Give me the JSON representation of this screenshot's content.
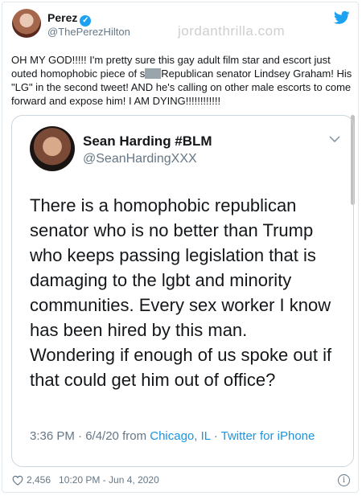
{
  "tweet": {
    "display_name": "Perez",
    "handle": "@ThePerezHilton",
    "verified_glyph": "✓",
    "text_before_redaction": "OH MY GOD!!!!! I'm pretty sure this gay adult film star and escort just outed homophobic piece of s",
    "text_after_redaction": "Republican senator Lindsey Graham! His \"LG\" in the second tweet! AND he's calling on other male escorts to come forward and expose him! I AM DYING!!!!!!!!!!!!",
    "likes": "2,456",
    "timestamp": "10:20 PM - Jun 4, 2020",
    "info_glyph": "i"
  },
  "watermark": "jordanthrilla.com",
  "quoted_tweet": {
    "display_name": "Sean Harding #BLM",
    "handle": "@SeanHardingXXX",
    "text": "There is a homophobic republican senator who is no better than Trump who keeps passing legislation that is damaging to the lgbt and minority communities. Every sex worker I know has been hired by this man. Wondering if enough of us spoke out if that could get him out of office?",
    "time": "3:36 PM · 6/4/20 from ",
    "location": "Chicago, IL",
    "separator": " · ",
    "source": "Twitter for iPhone"
  },
  "colors": {
    "twitter_blue": "#1da1f2",
    "link_blue": "#1b95e0",
    "secondary_text": "#657786",
    "border": "#e1e8ed"
  },
  "icons": [
    "twitter-bird-icon",
    "verified-badge-icon",
    "chevron-down-icon",
    "heart-icon",
    "info-icon"
  ]
}
